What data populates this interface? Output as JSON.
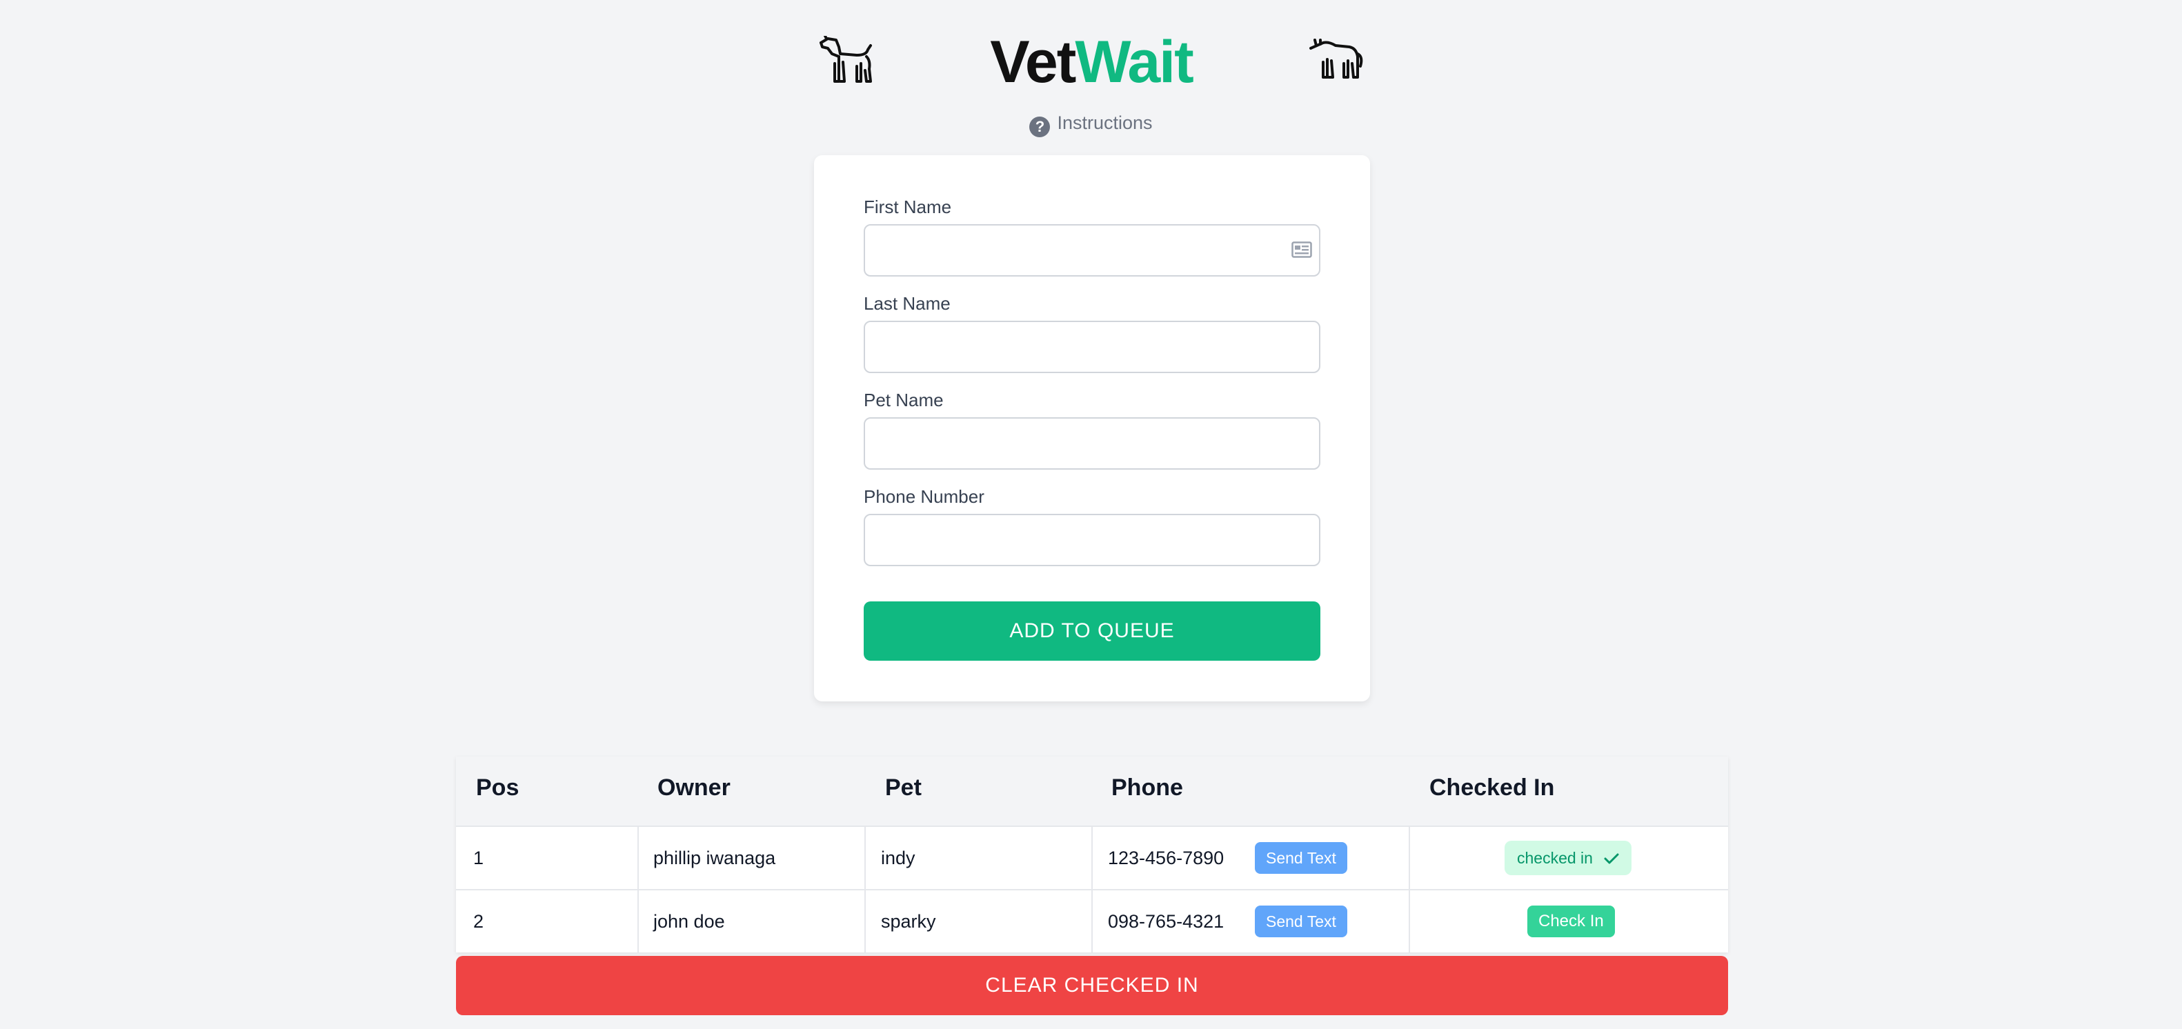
{
  "header": {
    "brand_part1": "Vet",
    "brand_part2": "Wait",
    "left_icon": "dog-icon",
    "right_icon": "cat-icon",
    "instructions_label": "Instructions",
    "instructions_icon": "question-circle-icon"
  },
  "form": {
    "fields": [
      {
        "label": "First Name",
        "value": "",
        "icon": "contact-card-icon"
      },
      {
        "label": "Last Name",
        "value": ""
      },
      {
        "label": "Pet Name",
        "value": ""
      },
      {
        "label": "Phone Number",
        "value": ""
      }
    ],
    "submit_label": "ADD TO QUEUE"
  },
  "queue": {
    "columns": [
      "Pos",
      "Owner",
      "Pet",
      "Phone",
      "Checked In"
    ],
    "rows": [
      {
        "pos": "1",
        "owner": "phillip iwanaga",
        "pet": "indy",
        "phone": "123-456-7890",
        "send_label": "Send Text",
        "checked_in": true,
        "status_label": "checked in",
        "status_icon": "checkmark-icon"
      },
      {
        "pos": "2",
        "owner": "john doe",
        "pet": "sparky",
        "phone": "098-765-4321",
        "send_label": "Send Text",
        "checked_in": false,
        "action_label": "Check In"
      }
    ]
  },
  "clear_label": "CLEAR CHECKED IN",
  "colors": {
    "brand_green": "#10b981",
    "send_blue": "#60a5fa",
    "clear_red": "#ef4444",
    "badge_bg": "#d1fae5"
  }
}
